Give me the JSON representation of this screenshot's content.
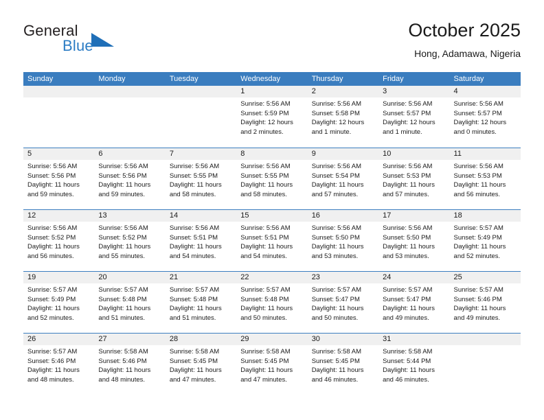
{
  "brand": {
    "word1": "General",
    "word2": "Blue",
    "logo_icon": "triangle-logo-icon",
    "accent_color": "#2b7cc4"
  },
  "header": {
    "title": "October 2025",
    "subtitle": "Hong, Adamawa, Nigeria"
  },
  "theme": {
    "header_blue": "#3a7dbf",
    "daynum_band": "#f0f0f0",
    "text": "#1a1a1a"
  },
  "weekdays": [
    "Sunday",
    "Monday",
    "Tuesday",
    "Wednesday",
    "Thursday",
    "Friday",
    "Saturday"
  ],
  "weeks": [
    [
      {
        "day": "",
        "sunrise": "",
        "sunset": "",
        "daylight1": "",
        "daylight2": ""
      },
      {
        "day": "",
        "sunrise": "",
        "sunset": "",
        "daylight1": "",
        "daylight2": ""
      },
      {
        "day": "",
        "sunrise": "",
        "sunset": "",
        "daylight1": "",
        "daylight2": ""
      },
      {
        "day": "1",
        "sunrise": "Sunrise: 5:56 AM",
        "sunset": "Sunset: 5:59 PM",
        "daylight1": "Daylight: 12 hours",
        "daylight2": "and 2 minutes."
      },
      {
        "day": "2",
        "sunrise": "Sunrise: 5:56 AM",
        "sunset": "Sunset: 5:58 PM",
        "daylight1": "Daylight: 12 hours",
        "daylight2": "and 1 minute."
      },
      {
        "day": "3",
        "sunrise": "Sunrise: 5:56 AM",
        "sunset": "Sunset: 5:57 PM",
        "daylight1": "Daylight: 12 hours",
        "daylight2": "and 1 minute."
      },
      {
        "day": "4",
        "sunrise": "Sunrise: 5:56 AM",
        "sunset": "Sunset: 5:57 PM",
        "daylight1": "Daylight: 12 hours",
        "daylight2": "and 0 minutes."
      }
    ],
    [
      {
        "day": "5",
        "sunrise": "Sunrise: 5:56 AM",
        "sunset": "Sunset: 5:56 PM",
        "daylight1": "Daylight: 11 hours",
        "daylight2": "and 59 minutes."
      },
      {
        "day": "6",
        "sunrise": "Sunrise: 5:56 AM",
        "sunset": "Sunset: 5:56 PM",
        "daylight1": "Daylight: 11 hours",
        "daylight2": "and 59 minutes."
      },
      {
        "day": "7",
        "sunrise": "Sunrise: 5:56 AM",
        "sunset": "Sunset: 5:55 PM",
        "daylight1": "Daylight: 11 hours",
        "daylight2": "and 58 minutes."
      },
      {
        "day": "8",
        "sunrise": "Sunrise: 5:56 AM",
        "sunset": "Sunset: 5:55 PM",
        "daylight1": "Daylight: 11 hours",
        "daylight2": "and 58 minutes."
      },
      {
        "day": "9",
        "sunrise": "Sunrise: 5:56 AM",
        "sunset": "Sunset: 5:54 PM",
        "daylight1": "Daylight: 11 hours",
        "daylight2": "and 57 minutes."
      },
      {
        "day": "10",
        "sunrise": "Sunrise: 5:56 AM",
        "sunset": "Sunset: 5:53 PM",
        "daylight1": "Daylight: 11 hours",
        "daylight2": "and 57 minutes."
      },
      {
        "day": "11",
        "sunrise": "Sunrise: 5:56 AM",
        "sunset": "Sunset: 5:53 PM",
        "daylight1": "Daylight: 11 hours",
        "daylight2": "and 56 minutes."
      }
    ],
    [
      {
        "day": "12",
        "sunrise": "Sunrise: 5:56 AM",
        "sunset": "Sunset: 5:52 PM",
        "daylight1": "Daylight: 11 hours",
        "daylight2": "and 56 minutes."
      },
      {
        "day": "13",
        "sunrise": "Sunrise: 5:56 AM",
        "sunset": "Sunset: 5:52 PM",
        "daylight1": "Daylight: 11 hours",
        "daylight2": "and 55 minutes."
      },
      {
        "day": "14",
        "sunrise": "Sunrise: 5:56 AM",
        "sunset": "Sunset: 5:51 PM",
        "daylight1": "Daylight: 11 hours",
        "daylight2": "and 54 minutes."
      },
      {
        "day": "15",
        "sunrise": "Sunrise: 5:56 AM",
        "sunset": "Sunset: 5:51 PM",
        "daylight1": "Daylight: 11 hours",
        "daylight2": "and 54 minutes."
      },
      {
        "day": "16",
        "sunrise": "Sunrise: 5:56 AM",
        "sunset": "Sunset: 5:50 PM",
        "daylight1": "Daylight: 11 hours",
        "daylight2": "and 53 minutes."
      },
      {
        "day": "17",
        "sunrise": "Sunrise: 5:56 AM",
        "sunset": "Sunset: 5:50 PM",
        "daylight1": "Daylight: 11 hours",
        "daylight2": "and 53 minutes."
      },
      {
        "day": "18",
        "sunrise": "Sunrise: 5:57 AM",
        "sunset": "Sunset: 5:49 PM",
        "daylight1": "Daylight: 11 hours",
        "daylight2": "and 52 minutes."
      }
    ],
    [
      {
        "day": "19",
        "sunrise": "Sunrise: 5:57 AM",
        "sunset": "Sunset: 5:49 PM",
        "daylight1": "Daylight: 11 hours",
        "daylight2": "and 52 minutes."
      },
      {
        "day": "20",
        "sunrise": "Sunrise: 5:57 AM",
        "sunset": "Sunset: 5:48 PM",
        "daylight1": "Daylight: 11 hours",
        "daylight2": "and 51 minutes."
      },
      {
        "day": "21",
        "sunrise": "Sunrise: 5:57 AM",
        "sunset": "Sunset: 5:48 PM",
        "daylight1": "Daylight: 11 hours",
        "daylight2": "and 51 minutes."
      },
      {
        "day": "22",
        "sunrise": "Sunrise: 5:57 AM",
        "sunset": "Sunset: 5:48 PM",
        "daylight1": "Daylight: 11 hours",
        "daylight2": "and 50 minutes."
      },
      {
        "day": "23",
        "sunrise": "Sunrise: 5:57 AM",
        "sunset": "Sunset: 5:47 PM",
        "daylight1": "Daylight: 11 hours",
        "daylight2": "and 50 minutes."
      },
      {
        "day": "24",
        "sunrise": "Sunrise: 5:57 AM",
        "sunset": "Sunset: 5:47 PM",
        "daylight1": "Daylight: 11 hours",
        "daylight2": "and 49 minutes."
      },
      {
        "day": "25",
        "sunrise": "Sunrise: 5:57 AM",
        "sunset": "Sunset: 5:46 PM",
        "daylight1": "Daylight: 11 hours",
        "daylight2": "and 49 minutes."
      }
    ],
    [
      {
        "day": "26",
        "sunrise": "Sunrise: 5:57 AM",
        "sunset": "Sunset: 5:46 PM",
        "daylight1": "Daylight: 11 hours",
        "daylight2": "and 48 minutes."
      },
      {
        "day": "27",
        "sunrise": "Sunrise: 5:58 AM",
        "sunset": "Sunset: 5:46 PM",
        "daylight1": "Daylight: 11 hours",
        "daylight2": "and 48 minutes."
      },
      {
        "day": "28",
        "sunrise": "Sunrise: 5:58 AM",
        "sunset": "Sunset: 5:45 PM",
        "daylight1": "Daylight: 11 hours",
        "daylight2": "and 47 minutes."
      },
      {
        "day": "29",
        "sunrise": "Sunrise: 5:58 AM",
        "sunset": "Sunset: 5:45 PM",
        "daylight1": "Daylight: 11 hours",
        "daylight2": "and 47 minutes."
      },
      {
        "day": "30",
        "sunrise": "Sunrise: 5:58 AM",
        "sunset": "Sunset: 5:45 PM",
        "daylight1": "Daylight: 11 hours",
        "daylight2": "and 46 minutes."
      },
      {
        "day": "31",
        "sunrise": "Sunrise: 5:58 AM",
        "sunset": "Sunset: 5:44 PM",
        "daylight1": "Daylight: 11 hours",
        "daylight2": "and 46 minutes."
      },
      {
        "day": "",
        "sunrise": "",
        "sunset": "",
        "daylight1": "",
        "daylight2": ""
      }
    ]
  ]
}
